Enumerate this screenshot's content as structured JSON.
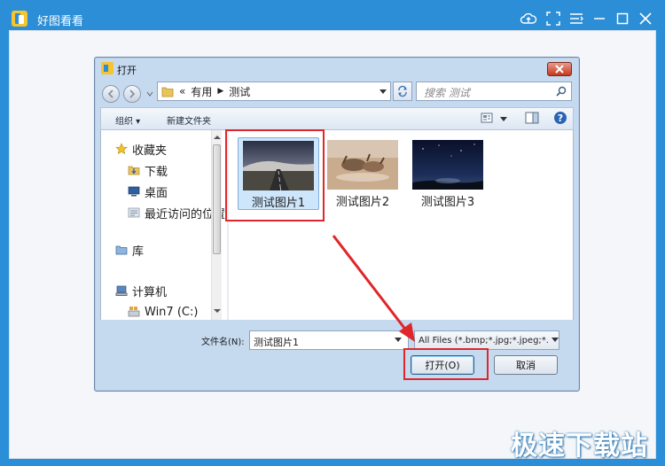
{
  "app": {
    "title": "好图看看"
  },
  "dialog": {
    "title": "打开",
    "address": {
      "overflow": "«",
      "segments": [
        "有用",
        "测试"
      ]
    },
    "search": {
      "placeholder": "搜索 测试"
    },
    "commands": {
      "organize": "组织 ▾",
      "new_folder": "新建文件夹"
    },
    "nav_pane": {
      "favorites": "收藏夹",
      "downloads": "下载",
      "desktop": "桌面",
      "recent": "最近访问的位置",
      "libraries": "库",
      "computer": "计算机",
      "drive_c": "Win7 (C:)"
    },
    "files": [
      {
        "name": "测试图片1",
        "selected": true
      },
      {
        "name": "测试图片2",
        "selected": false
      },
      {
        "name": "测试图片3",
        "selected": false
      }
    ],
    "filename": {
      "label": "文件名(N):",
      "value": "测试图片1"
    },
    "filetype": {
      "value": "All Files (*.bmp;*.jpg;*.jpeg;*."
    },
    "buttons": {
      "open": "打开(O)",
      "cancel": "取消"
    }
  },
  "watermark": "极速下载站",
  "colors": {
    "app_titlebar": "#2b8ed6",
    "highlight_red": "#e0262b",
    "selection": "#cde6fb"
  }
}
